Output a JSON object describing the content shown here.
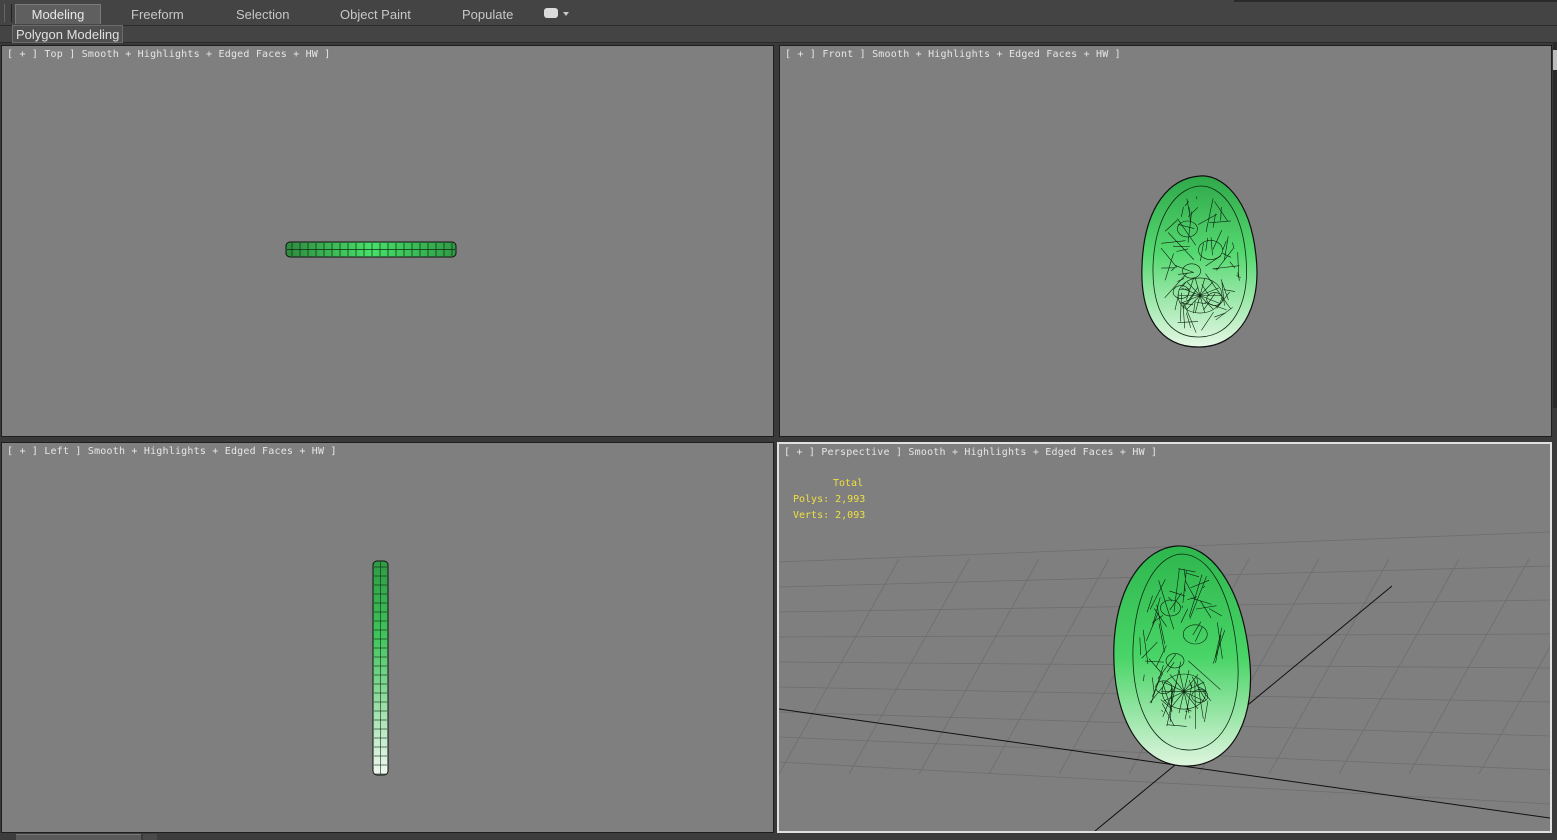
{
  "ribbon": {
    "tabs": [
      "Modeling",
      "Freeform",
      "Selection",
      "Object Paint",
      "Populate"
    ],
    "active_tab": "Modeling",
    "more_icon": "menu-toggle-icon"
  },
  "subbar": {
    "label": "Polygon Modeling"
  },
  "viewports": {
    "top": {
      "label": "[ + ] Top ] Smooth + Highlights + Edged Faces + HW ]"
    },
    "front": {
      "label": "[ + ] Front ] Smooth + Highlights + Edged Faces + HW ]"
    },
    "left": {
      "label": "[ + ] Left ] Smooth + Highlights + Edged Faces + HW ]"
    },
    "perspective": {
      "label": "[ + ] Perspective ] Smooth + Highlights + Edged Faces + HW ]",
      "stats": {
        "title": "Total",
        "polys": "Polys: 2,993",
        "verts": "Verts: 2,093"
      }
    }
  },
  "colors": {
    "viewport_bg": "#7f7f7f",
    "mesh_green": "#3cc85a",
    "stats_text": "#f0e040",
    "active_viewport_border": "#e0e0e0"
  }
}
